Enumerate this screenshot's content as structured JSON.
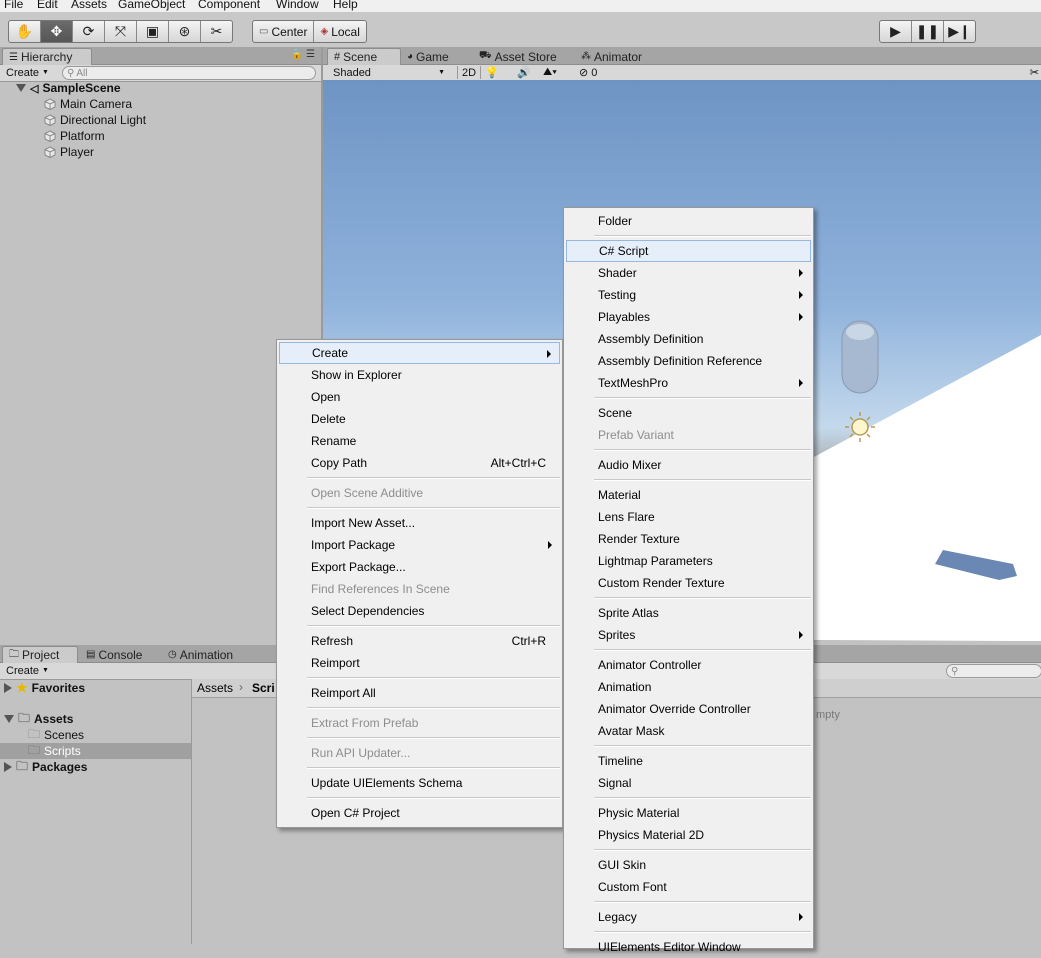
{
  "menubar": {
    "items": [
      "File",
      "Edit",
      "Assets",
      "GameObject",
      "Component",
      "Window",
      "Help"
    ]
  },
  "toolbar": {
    "tools": [
      "hand-tool",
      "move-tool",
      "rotate-tool",
      "scale-tool",
      "rect-tool",
      "transform-tool",
      "custom-tool"
    ],
    "active_tool": "move-tool",
    "pivot_label": "Center",
    "space_label": "Local",
    "play": [
      "play",
      "pause",
      "step"
    ]
  },
  "hierarchy": {
    "tab_label": "Hierarchy",
    "create_label": "Create",
    "search_placeholder": "All",
    "scene_name": "SampleScene",
    "objects": [
      "Main Camera",
      "Directional Light",
      "Platform",
      "Player"
    ]
  },
  "scene": {
    "tabs": [
      "Scene",
      "Game",
      "Asset Store",
      "Animator"
    ],
    "shading": "Shaded",
    "mode_2d": "2D",
    "hidden_count": "0"
  },
  "project": {
    "tabs": [
      "Project",
      "Console",
      "Animation"
    ],
    "create_label": "Create",
    "favorites": "Favorites",
    "assets": "Assets",
    "folders": [
      "Scenes",
      "Scripts"
    ],
    "packages": "Packages",
    "breadcrumb_root": "Assets",
    "breadcrumb_current": "Scri",
    "empty_fragment": "mpty"
  },
  "context_menu": {
    "items": [
      {
        "label": "Create",
        "submenu": true,
        "highlight": true
      },
      {
        "label": "Show in Explorer"
      },
      {
        "label": "Open"
      },
      {
        "label": "Delete"
      },
      {
        "label": "Rename"
      },
      {
        "label": "Copy Path",
        "shortcut": "Alt+Ctrl+C"
      },
      {
        "sep": true
      },
      {
        "label": "Open Scene Additive",
        "disabled": true
      },
      {
        "sep": true
      },
      {
        "label": "Import New Asset..."
      },
      {
        "label": "Import Package",
        "submenu": true
      },
      {
        "label": "Export Package..."
      },
      {
        "label": "Find References In Scene",
        "disabled": true
      },
      {
        "label": "Select Dependencies"
      },
      {
        "sep": true
      },
      {
        "label": "Refresh",
        "shortcut": "Ctrl+R"
      },
      {
        "label": "Reimport"
      },
      {
        "sep": true
      },
      {
        "label": "Reimport All"
      },
      {
        "sep": true
      },
      {
        "label": "Extract From Prefab",
        "disabled": true
      },
      {
        "sep": true
      },
      {
        "label": "Run API Updater...",
        "disabled": true
      },
      {
        "sep": true
      },
      {
        "label": "Update UIElements Schema"
      },
      {
        "sep": true
      },
      {
        "label": "Open C# Project"
      }
    ]
  },
  "create_submenu": {
    "items": [
      {
        "label": "Folder"
      },
      {
        "sep": true
      },
      {
        "label": "C# Script",
        "highlight": true
      },
      {
        "label": "Shader",
        "submenu": true
      },
      {
        "label": "Testing",
        "submenu": true
      },
      {
        "label": "Playables",
        "submenu": true
      },
      {
        "label": "Assembly Definition"
      },
      {
        "label": "Assembly Definition Reference"
      },
      {
        "label": "TextMeshPro",
        "submenu": true
      },
      {
        "sep": true
      },
      {
        "label": "Scene"
      },
      {
        "label": "Prefab Variant",
        "disabled": true
      },
      {
        "sep": true
      },
      {
        "label": "Audio Mixer"
      },
      {
        "sep": true
      },
      {
        "label": "Material"
      },
      {
        "label": "Lens Flare"
      },
      {
        "label": "Render Texture"
      },
      {
        "label": "Lightmap Parameters"
      },
      {
        "label": "Custom Render Texture"
      },
      {
        "sep": true
      },
      {
        "label": "Sprite Atlas"
      },
      {
        "label": "Sprites",
        "submenu": true
      },
      {
        "sep": true
      },
      {
        "label": "Animator Controller"
      },
      {
        "label": "Animation"
      },
      {
        "label": "Animator Override Controller"
      },
      {
        "label": "Avatar Mask"
      },
      {
        "sep": true
      },
      {
        "label": "Timeline"
      },
      {
        "label": "Signal"
      },
      {
        "sep": true
      },
      {
        "label": "Physic Material"
      },
      {
        "label": "Physics Material 2D"
      },
      {
        "sep": true
      },
      {
        "label": "GUI Skin"
      },
      {
        "label": "Custom Font"
      },
      {
        "sep": true
      },
      {
        "label": "Legacy",
        "submenu": true
      },
      {
        "sep": true
      },
      {
        "label": "UIElements Editor Window"
      }
    ]
  }
}
